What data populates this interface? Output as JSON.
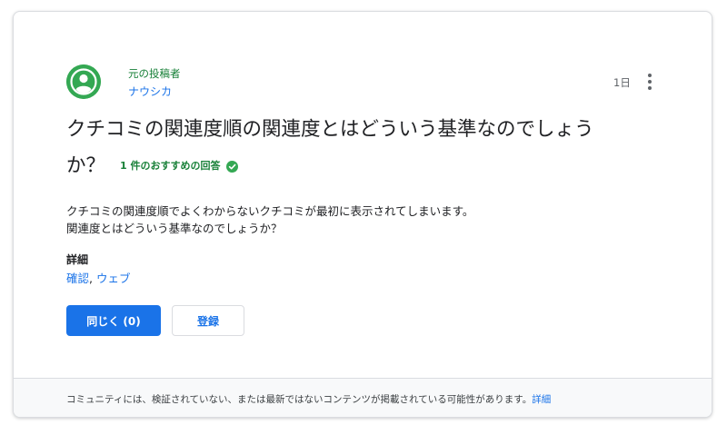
{
  "post": {
    "role_label": "元の投稿者",
    "author": "ナウシカ",
    "time": "1日",
    "title": "クチコミの関連度順の関連度とはどういう基準なのでしょうか？",
    "recommended": "1 件のおすすめの回答",
    "body_line1": "クチコミの関連度順でよくわからないクチコミが最初に表示されてしまいます。",
    "body_line2": "関連度とはどういう基準なのでしょうか？",
    "details_label": "詳細",
    "details_links": [
      "確認",
      "ウェブ"
    ],
    "details_separator": ", "
  },
  "actions": {
    "same_question": "同じく (0)",
    "subscribe": "登録"
  },
  "footer": {
    "disclaimer": "コミュニティには、検証されていない、または最新ではないコンテンツが掲載されている可能性があります。",
    "link": "詳細"
  },
  "colors": {
    "accent": "#1a73e8",
    "success": "#188038",
    "avatar": "#34a853"
  },
  "icons": [
    "account-circle-icon",
    "more-vert-icon",
    "check-circle-icon"
  ]
}
